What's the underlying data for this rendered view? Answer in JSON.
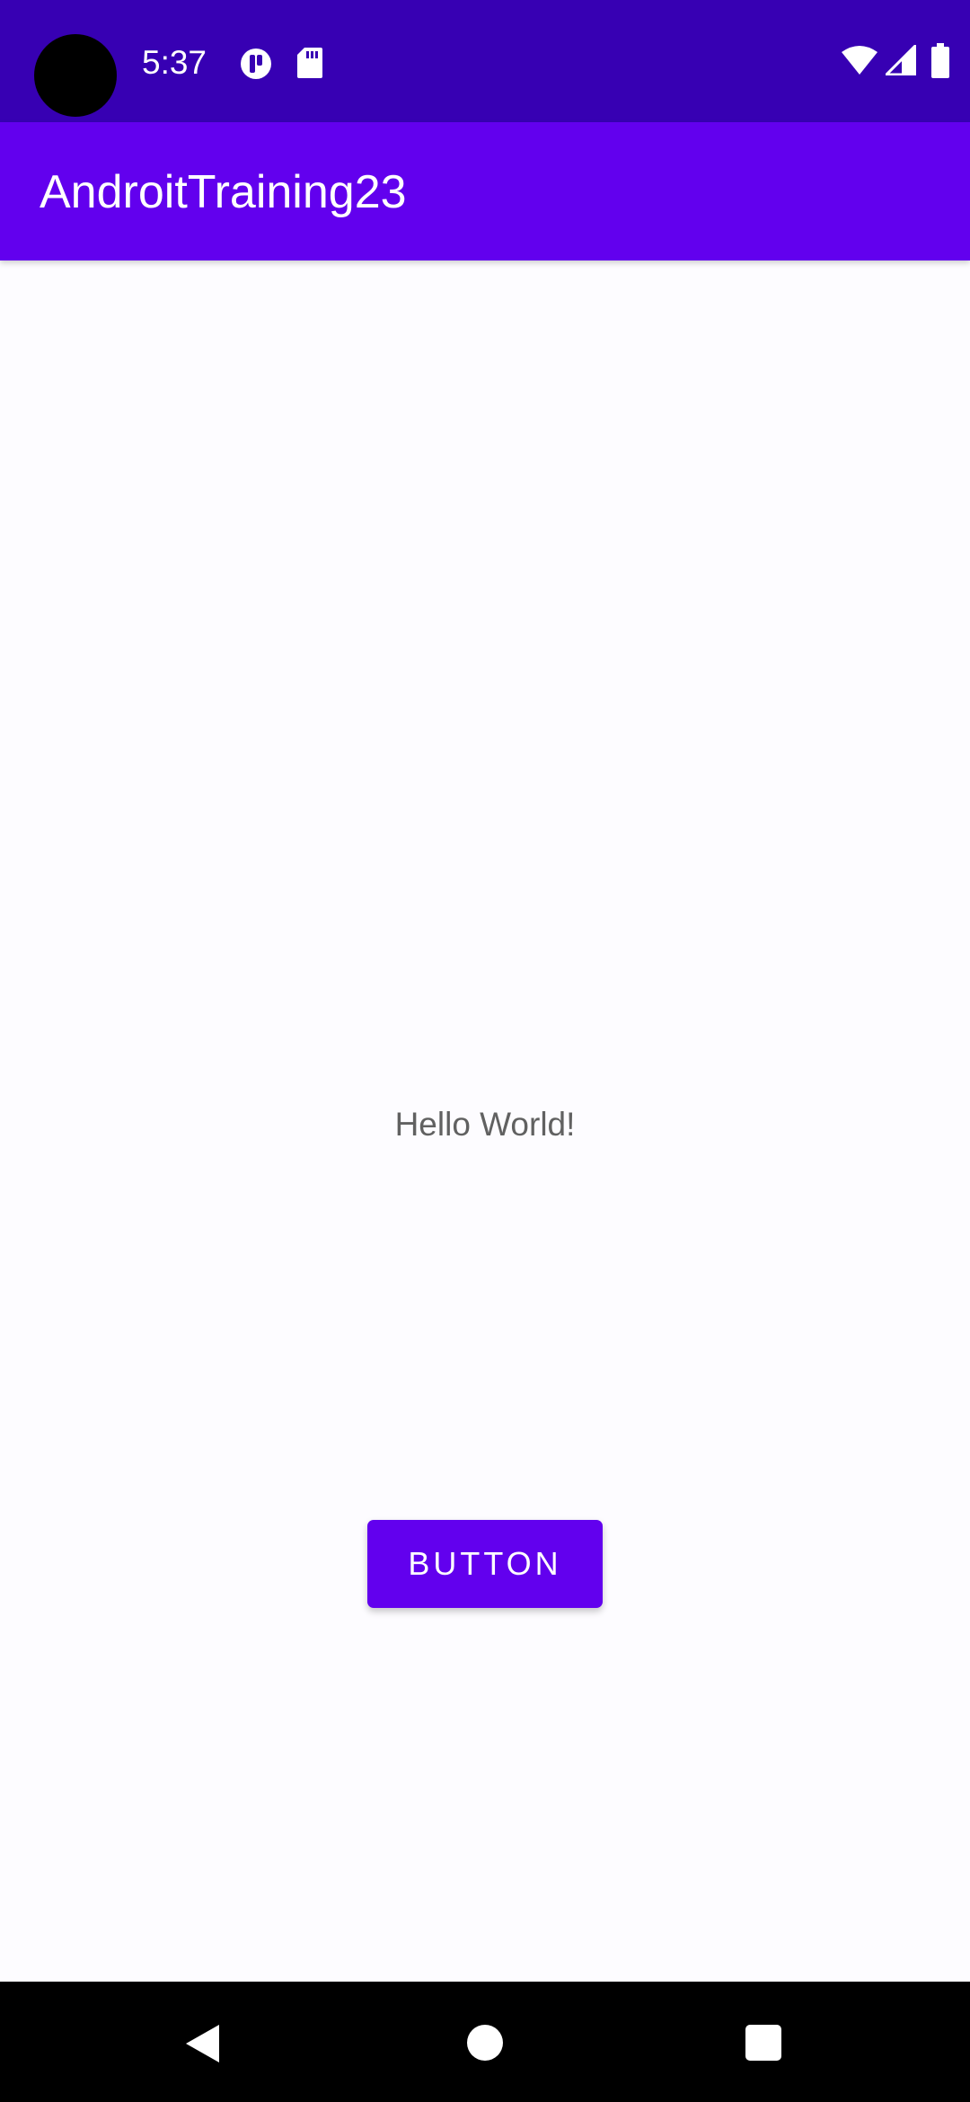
{
  "status_bar": {
    "time": "5:37",
    "icons": [
      "app-notification-icon",
      "sd-card-icon",
      "wifi-icon",
      "cell-signal-icon",
      "battery-icon"
    ],
    "background_color": "#3700b3"
  },
  "app_bar": {
    "title": "AndroitTraining23",
    "background_color": "#6200ee"
  },
  "main": {
    "hello_text": "Hello World!",
    "button_label": "BUTTON",
    "button_color": "#6200ee"
  },
  "nav_bar": {
    "icons": [
      "back-icon",
      "home-icon",
      "recents-icon"
    ]
  }
}
